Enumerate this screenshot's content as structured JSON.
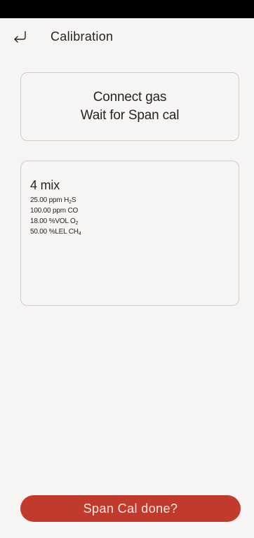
{
  "header": {
    "back_icon": "return-arrow-icon",
    "title": "Calibration"
  },
  "instruction": {
    "line1": "Connect gas",
    "line2": "Wait for Span cal"
  },
  "gas_mix": {
    "title": "4 mix",
    "components": [
      {
        "value": "25.00",
        "unit": "ppm",
        "formula": "H",
        "sub": "2",
        "formula_tail": "S"
      },
      {
        "value": "100.00",
        "unit": "ppm",
        "formula": "CO",
        "sub": "",
        "formula_tail": ""
      },
      {
        "value": "18.00",
        "unit": "%VOL",
        "formula": "O",
        "sub": "2",
        "formula_tail": ""
      },
      {
        "value": "50.00",
        "unit": "%LEL",
        "formula": "CH",
        "sub": "4",
        "formula_tail": ""
      }
    ]
  },
  "action": {
    "label": "Span Cal done?"
  },
  "colors": {
    "accent": "#c23a2b",
    "background": "#f7f5f4",
    "status_bar": "#000000"
  }
}
